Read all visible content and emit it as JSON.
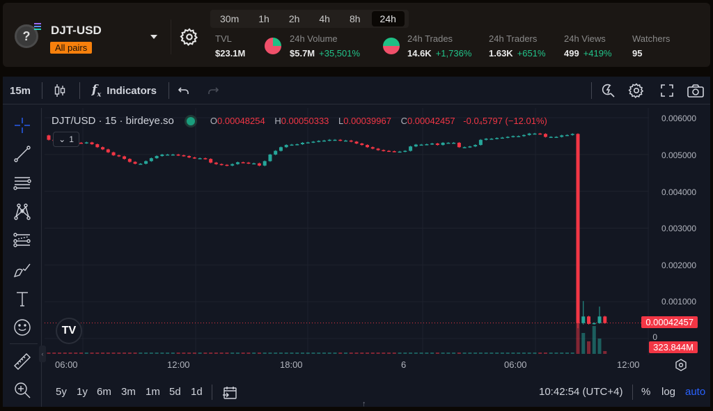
{
  "header": {
    "pair_name": "DJT-USD",
    "pair_badge": "All pairs",
    "token_icon": "question-icon",
    "chain_icon": "solana-icon",
    "time_ranges": [
      "30m",
      "1h",
      "2h",
      "4h",
      "8h",
      "24h"
    ],
    "active_range": "24h",
    "stats": {
      "tvl": {
        "label": "TVL",
        "value": "$23.1M"
      },
      "volume": {
        "label": "24h Volume",
        "value": "$5.7M",
        "change": "+35,501%"
      },
      "trades": {
        "label": "24h Trades",
        "value": "14.6K",
        "change": "+1,736%"
      },
      "traders": {
        "label": "24h Traders",
        "value": "1.63K",
        "change": "+651%"
      },
      "views": {
        "label": "24h Views",
        "value": "499",
        "change": "+419%"
      },
      "watchers": {
        "label": "Watchers",
        "value": "95"
      }
    },
    "volume_pie": {
      "buy_fraction": 0.25
    },
    "trades_pie": {
      "buy_fraction": 0.5
    }
  },
  "toolbar": {
    "interval": "15m",
    "indicators_label": "Indicators"
  },
  "legend": {
    "title": "DJT/USD · 15 · birdeye.so",
    "o_key": "O",
    "o_val": "0.00048254",
    "h_key": "H",
    "h_val": "0.00050333",
    "l_key": "L",
    "l_val": "0.00039967",
    "c_key": "C",
    "c_val": "0.00042457",
    "change": "-0.0₄5797 (−12.01%)",
    "collapse_label": "1"
  },
  "price_axis": {
    "ticks": [
      "0.006000",
      "0.005000",
      "0.004000",
      "0.003000",
      "0.002000",
      "0.001000",
      "0"
    ],
    "last_price": "0.00042457",
    "volume_label": "323.844M"
  },
  "time_axis": {
    "ticks": [
      "06:00",
      "12:00",
      "18:00",
      "6",
      "06:00",
      "12:00"
    ]
  },
  "bottom": {
    "ranges": [
      "5y",
      "1y",
      "6m",
      "3m",
      "1m",
      "5d",
      "1d"
    ],
    "clock": "10:42:54 (UTC+4)",
    "percent": "%",
    "log": "log",
    "auto": "auto"
  },
  "colors": {
    "up": "#26a69a",
    "down": "#f23645",
    "accent": "#2962ff",
    "badge": "#f7800c"
  },
  "chart_data": {
    "type": "candlestick",
    "ylim": [
      0,
      0.006
    ],
    "y_ticks": [
      0,
      0.001,
      0.002,
      0.003,
      0.004,
      0.005,
      0.006
    ],
    "close": [
      0.0054,
      0.00538,
      0.00535,
      0.00534,
      0.00533,
      0.00532,
      0.00531,
      0.00533,
      0.00528,
      0.0052,
      0.00514,
      0.00506,
      0.00498,
      0.00495,
      0.00488,
      0.0048,
      0.00475,
      0.00475,
      0.00482,
      0.0049,
      0.00496,
      0.005,
      0.005,
      0.005,
      0.00498,
      0.00496,
      0.00492,
      0.0049,
      0.0049,
      0.00488,
      0.00478,
      0.00474,
      0.00472,
      0.0047,
      0.00474,
      0.00479,
      0.00478,
      0.00476,
      0.00476,
      0.0047,
      0.00482,
      0.005,
      0.0051,
      0.0052,
      0.00526,
      0.00527,
      0.00528,
      0.00532,
      0.00533,
      0.00535,
      0.00537,
      0.00538,
      0.0054,
      0.0054,
      0.00538,
      0.00538,
      0.00535,
      0.0053,
      0.00526,
      0.0052,
      0.00516,
      0.00512,
      0.0051,
      0.00509,
      0.00508,
      0.00508,
      0.0051,
      0.00522,
      0.00527,
      0.00527,
      0.00528,
      0.0053,
      0.00526,
      0.00532,
      0.00532,
      0.00532,
      0.0052,
      0.0052,
      0.00522,
      0.00526,
      0.0054,
      0.00543,
      0.00543,
      0.00545,
      0.00546,
      0.00548,
      0.0055,
      0.0055,
      0.00553,
      0.00557,
      0.00557,
      0.00556,
      0.00548,
      0.00548,
      0.00548,
      0.00552,
      0.00553,
      0.00556,
      0.00042,
      0.0006,
      0.0004,
      0.00042,
      0.0006,
      0.00042
    ],
    "open_change_sign": "derived"
  }
}
